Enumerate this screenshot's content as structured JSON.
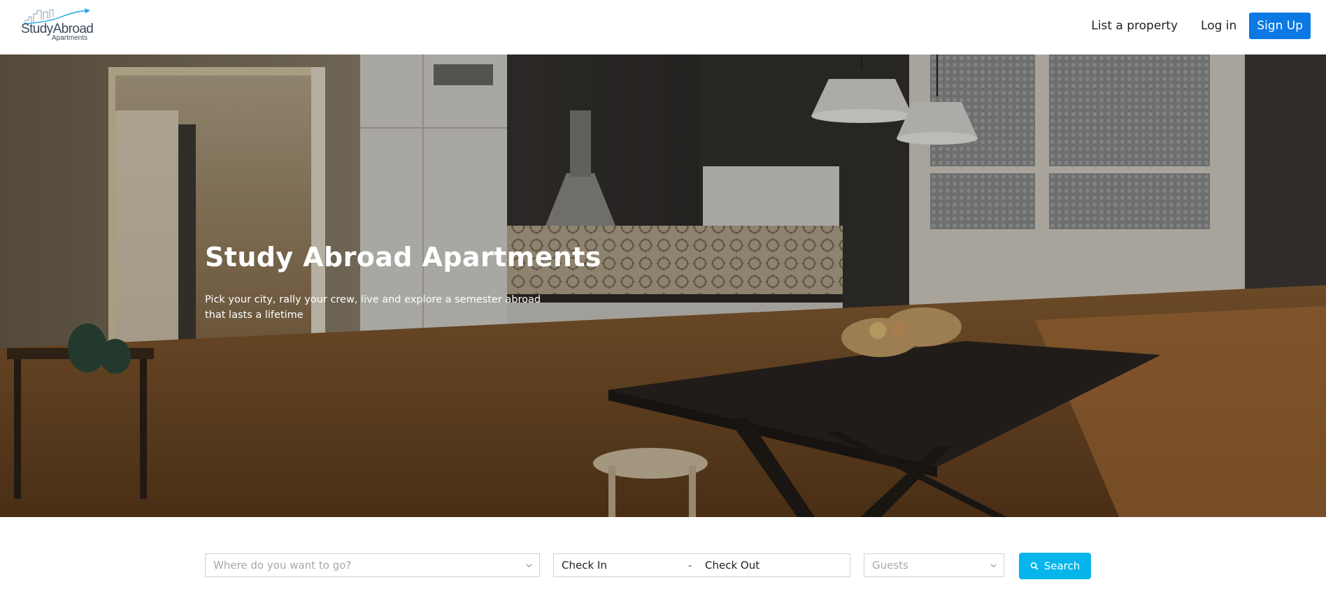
{
  "brand": {
    "logo_main": "StudyAbroad",
    "logo_sub": "Apartments"
  },
  "nav": {
    "list_property": "List a property",
    "login": "Log in",
    "signup": "Sign Up"
  },
  "hero": {
    "title": "Study Abroad Apartments",
    "subtitle": "Pick your city, rally your crew, live and explore a semester abroad that lasts a lifetime"
  },
  "search": {
    "destination_placeholder": "Where do you want to go?",
    "check_in": "Check In",
    "date_separator": "-",
    "check_out": "Check Out",
    "guests_placeholder": "Guests",
    "button_label": "Search",
    "icon": "search-icon"
  },
  "colors": {
    "signup_bg": "#0b78e3",
    "search_button_bg": "#05b5ec",
    "placeholder_text": "#a8a8a8"
  }
}
